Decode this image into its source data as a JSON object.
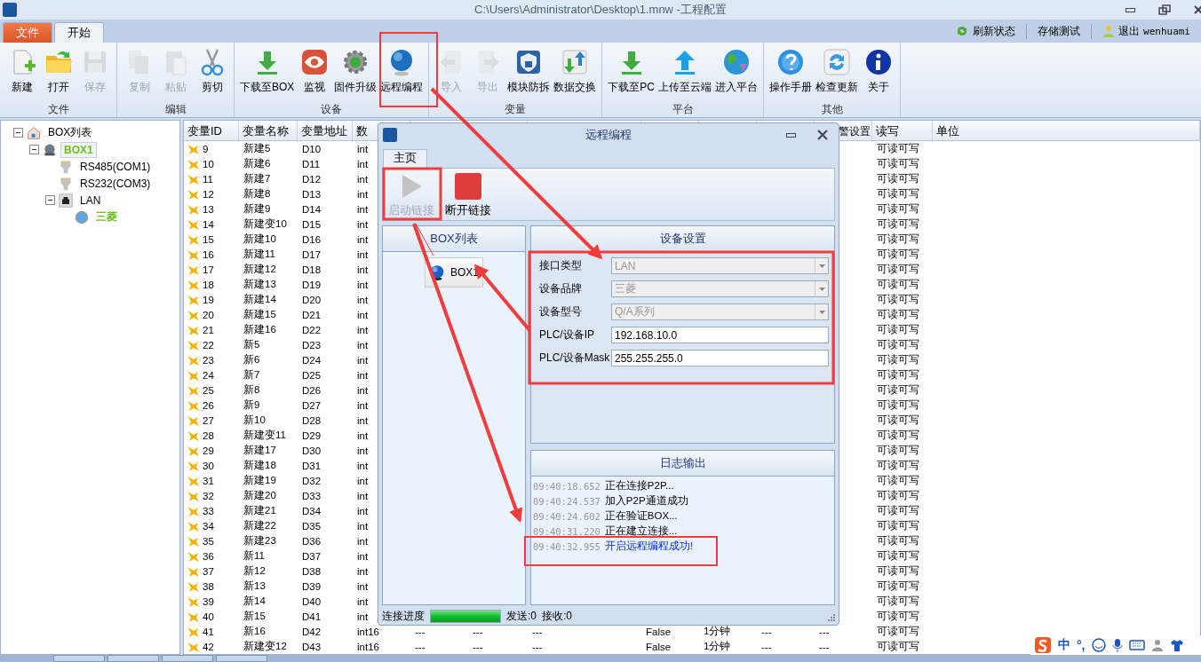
{
  "window": {
    "title": "C:\\Users\\Administrator\\Desktop\\1.mnw -工程配置"
  },
  "ribbon": {
    "tabs": [
      {
        "label": "文件",
        "kind": "file",
        "selected": false
      },
      {
        "label": "开始",
        "kind": "normal",
        "selected": true
      }
    ],
    "links": [
      {
        "label": "刷新状态",
        "kind": "refresh"
      },
      {
        "label": "存储测试",
        "kind": "plain"
      },
      {
        "label": "退出",
        "kind": "user",
        "user": "wenhuami"
      }
    ],
    "groups": [
      {
        "label": "文件",
        "buttons": [
          {
            "label": "新建",
            "disabled": false
          },
          {
            "label": "打开",
            "disabled": false
          },
          {
            "label": "保存",
            "disabled": true
          }
        ]
      },
      {
        "label": "编辑",
        "buttons": [
          {
            "label": "复制",
            "disabled": true
          },
          {
            "label": "粘贴",
            "disabled": true
          },
          {
            "label": "剪切",
            "disabled": false
          }
        ]
      },
      {
        "label": "设备",
        "buttons": [
          {
            "label": "下载至BOX",
            "disabled": false
          },
          {
            "label": "监视",
            "disabled": false
          },
          {
            "label": "固件升级",
            "disabled": false
          },
          {
            "label": "远程编程",
            "disabled": false
          }
        ]
      },
      {
        "label": "变量",
        "buttons": [
          {
            "label": "导入",
            "disabled": true
          },
          {
            "label": "导出",
            "disabled": true
          },
          {
            "label": "模块防拆",
            "disabled": false
          },
          {
            "label": "数据交换",
            "disabled": false
          }
        ]
      },
      {
        "label": "平台",
        "buttons": [
          {
            "label": "下载至PC",
            "disabled": false
          },
          {
            "label": "上传至云端",
            "disabled": false
          },
          {
            "label": "进入平台",
            "disabled": false
          }
        ]
      },
      {
        "label": "其他",
        "buttons": [
          {
            "label": "操作手册",
            "disabled": false
          },
          {
            "label": "检查更新",
            "disabled": false
          },
          {
            "label": "关于",
            "disabled": false
          }
        ]
      }
    ]
  },
  "tree": [
    {
      "label": "BOX列表",
      "kind": "root",
      "expanded": true,
      "selected": false,
      "connected": false,
      "children": [
        {
          "label": "BOX1",
          "kind": "box",
          "expanded": true,
          "selected": true,
          "connected": true,
          "children": [
            {
              "label": "RS485(COM1)",
              "kind": "port",
              "selected": false,
              "connected": false
            },
            {
              "label": "RS232(COM3)",
              "kind": "port",
              "selected": false,
              "connected": false
            },
            {
              "label": "LAN",
              "kind": "lan",
              "expanded": true,
              "selected": false,
              "connected": false,
              "children": [
                {
                  "label": "三菱",
                  "kind": "plc",
                  "selected": false,
                  "connected": true
                }
              ]
            }
          ]
        }
      ]
    }
  ],
  "table": {
    "columns": [
      "变量ID",
      "变量名称",
      "变量地址",
      "数"
    ],
    "right_columns": [
      "警设置",
      "读写",
      "单位"
    ],
    "rows": [
      {
        "id": "9",
        "name": "新建5",
        "address": "D10",
        "type": "int",
        "access": "可读可写"
      },
      {
        "id": "10",
        "name": "新建6",
        "address": "D11",
        "type": "int",
        "access": "可读可写"
      },
      {
        "id": "11",
        "name": "新建7",
        "address": "D12",
        "type": "int",
        "access": "可读可写"
      },
      {
        "id": "12",
        "name": "新建8",
        "address": "D13",
        "type": "int",
        "access": "可读可写"
      },
      {
        "id": "13",
        "name": "新建9",
        "address": "D14",
        "type": "int",
        "access": "可读可写"
      },
      {
        "id": "14",
        "name": "新建变10",
        "address": "D15",
        "type": "int",
        "access": "可读可写"
      },
      {
        "id": "15",
        "name": "新建10",
        "address": "D16",
        "type": "int",
        "access": "可读可写"
      },
      {
        "id": "16",
        "name": "新建11",
        "address": "D17",
        "type": "int",
        "access": "可读可写"
      },
      {
        "id": "17",
        "name": "新建12",
        "address": "D18",
        "type": "int",
        "access": "可读可写"
      },
      {
        "id": "18",
        "name": "新建13",
        "address": "D19",
        "type": "int",
        "access": "可读可写"
      },
      {
        "id": "19",
        "name": "新建14",
        "address": "D20",
        "type": "int",
        "access": "可读可写"
      },
      {
        "id": "20",
        "name": "新建15",
        "address": "D21",
        "type": "int",
        "access": "可读可写"
      },
      {
        "id": "21",
        "name": "新建16",
        "address": "D22",
        "type": "int",
        "access": "可读可写"
      },
      {
        "id": "22",
        "name": "新5",
        "address": "D23",
        "type": "int",
        "access": "可读可写"
      },
      {
        "id": "23",
        "name": "新6",
        "address": "D24",
        "type": "int",
        "access": "可读可写"
      },
      {
        "id": "24",
        "name": "新7",
        "address": "D25",
        "type": "int",
        "access": "可读可写"
      },
      {
        "id": "25",
        "name": "新8",
        "address": "D26",
        "type": "int",
        "access": "可读可写"
      },
      {
        "id": "26",
        "name": "新9",
        "address": "D27",
        "type": "int",
        "access": "可读可写"
      },
      {
        "id": "27",
        "name": "新10",
        "address": "D28",
        "type": "int",
        "access": "可读可写"
      },
      {
        "id": "28",
        "name": "新建变11",
        "address": "D29",
        "type": "int",
        "access": "可读可写"
      },
      {
        "id": "29",
        "name": "新建17",
        "address": "D30",
        "type": "int",
        "access": "可读可写"
      },
      {
        "id": "30",
        "name": "新建18",
        "address": "D31",
        "type": "int",
        "access": "可读可写"
      },
      {
        "id": "31",
        "name": "新建19",
        "address": "D32",
        "type": "int",
        "access": "可读可写"
      },
      {
        "id": "32",
        "name": "新建20",
        "address": "D33",
        "type": "int",
        "access": "可读可写"
      },
      {
        "id": "33",
        "name": "新建21",
        "address": "D34",
        "type": "int",
        "access": "可读可写"
      },
      {
        "id": "34",
        "name": "新建22",
        "address": "D35",
        "type": "int",
        "access": "可读可写"
      },
      {
        "id": "35",
        "name": "新建23",
        "address": "D36",
        "type": "int",
        "access": "可读可写"
      },
      {
        "id": "36",
        "name": "新11",
        "address": "D37",
        "type": "int",
        "access": "可读可写"
      },
      {
        "id": "37",
        "name": "新12",
        "address": "D38",
        "type": "int",
        "access": "可读可写"
      },
      {
        "id": "38",
        "name": "新13",
        "address": "D39",
        "type": "int",
        "access": "可读可写"
      },
      {
        "id": "39",
        "name": "新14",
        "address": "D40",
        "type": "int",
        "access": "可读可写"
      },
      {
        "id": "40",
        "name": "新15",
        "address": "D41",
        "type": "int",
        "access": "可读可写"
      },
      {
        "id": "41",
        "name": "新16",
        "address": "D42",
        "type": "int16",
        "values": [
          "---",
          "---",
          "---",
          "False",
          "1分钟",
          "---",
          "---"
        ],
        "access": "可读可写"
      },
      {
        "id": "42",
        "name": "新建变12",
        "address": "D43",
        "type": "int16",
        "values": [
          "---",
          "---",
          "---",
          "False",
          "1分钟",
          "---",
          "---"
        ],
        "access": "可读可写"
      }
    ]
  },
  "dialog": {
    "title": "远程编程",
    "tab": {
      "label": "主页",
      "selected": true
    },
    "toolbar": [
      {
        "label": "启动链接",
        "kind": "start",
        "disabled": true
      },
      {
        "label": "断开链接",
        "kind": "stop",
        "disabled": false
      }
    ],
    "box_list": {
      "title": "BOX列表",
      "items": [
        {
          "label": "BOX1"
        }
      ]
    },
    "settings": {
      "title": "设备设置",
      "fields": [
        {
          "label": "接口类型",
          "kind": "select",
          "value": "LAN",
          "disabled": true
        },
        {
          "label": "设备品牌",
          "kind": "select",
          "value": "三菱",
          "disabled": true
        },
        {
          "label": "设备型号",
          "kind": "select",
          "value": "Q/A系列",
          "disabled": true
        },
        {
          "label": "PLC/设备IP",
          "kind": "input",
          "value": "192.168.10.0",
          "disabled": false
        },
        {
          "label": "PLC/设备Mask",
          "kind": "input",
          "value": "255.255.255.0",
          "disabled": false
        }
      ]
    },
    "log": {
      "title": "日志输出",
      "lines": [
        {
          "time": "09:40:18.652",
          "message": "正在连接P2P...",
          "kind": "info"
        },
        {
          "time": "09:40:24.537",
          "message": "加入P2P通道成功",
          "kind": "info"
        },
        {
          "time": "09:40:24.602",
          "message": "正在验证BOX...",
          "kind": "info"
        },
        {
          "time": "09:40:31.220",
          "message": "正在建立连接...",
          "kind": "info"
        },
        {
          "time": "09:40:32.955",
          "message": "开启远程编程成功!",
          "kind": "success"
        }
      ]
    },
    "status": {
      "label": "连接进度",
      "level": 1,
      "sent": "发送:0",
      "received": "接收:0"
    }
  },
  "ime": {
    "mode": "中",
    "punct": "°,"
  }
}
